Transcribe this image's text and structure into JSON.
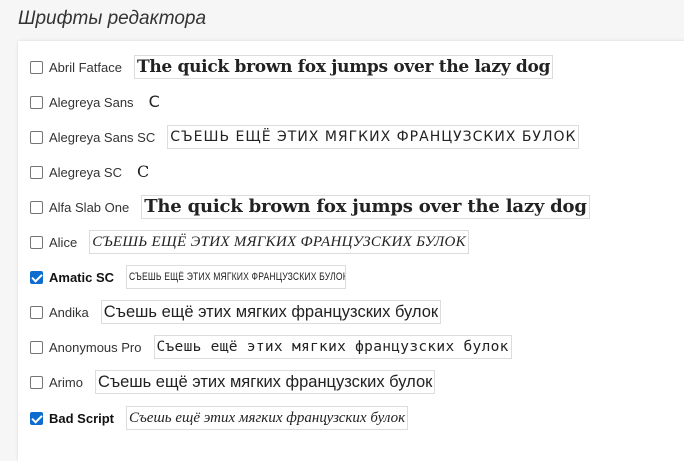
{
  "page": {
    "title": "Шрифты редактора"
  },
  "fonts": [
    {
      "name": "Abril Fatface",
      "checked": false,
      "sample": "The quick brown fox jumps over the lazy dog"
    },
    {
      "name": "Alegreya Sans",
      "checked": false,
      "sample": "С"
    },
    {
      "name": "Alegreya Sans SC",
      "checked": false,
      "sample": "СЪЕШЬ ЕЩЁ ЭТИХ МЯГКИХ ФРАНЦУЗСКИХ БУЛОК"
    },
    {
      "name": "Alegreya SC",
      "checked": false,
      "sample": "С"
    },
    {
      "name": "Alfa Slab One",
      "checked": false,
      "sample": "The quick brown fox jumps over the lazy dog"
    },
    {
      "name": "Alice",
      "checked": false,
      "sample": "СЪЕШЬ ЕЩЁ ЭТИХ МЯГКИХ ФРАНЦУЗСКИХ БУЛОК"
    },
    {
      "name": "Amatic SC",
      "checked": true,
      "sample": "СЪЕШЬ ЕЩЁ ЭТИХ МЯГКИХ ФРАНЦУЗСКИХ БУЛОК"
    },
    {
      "name": "Andika",
      "checked": false,
      "sample": "Съешь ещё этих мягких французских булок"
    },
    {
      "name": "Anonymous Pro",
      "checked": false,
      "sample": "Съешь ещё этих мягких французских булок"
    },
    {
      "name": "Arimo",
      "checked": false,
      "sample": "Съешь ещё этих мягких французских булок"
    },
    {
      "name": "Bad Script",
      "checked": true,
      "sample": "Съешь ещё этих мягких французских булок"
    }
  ]
}
